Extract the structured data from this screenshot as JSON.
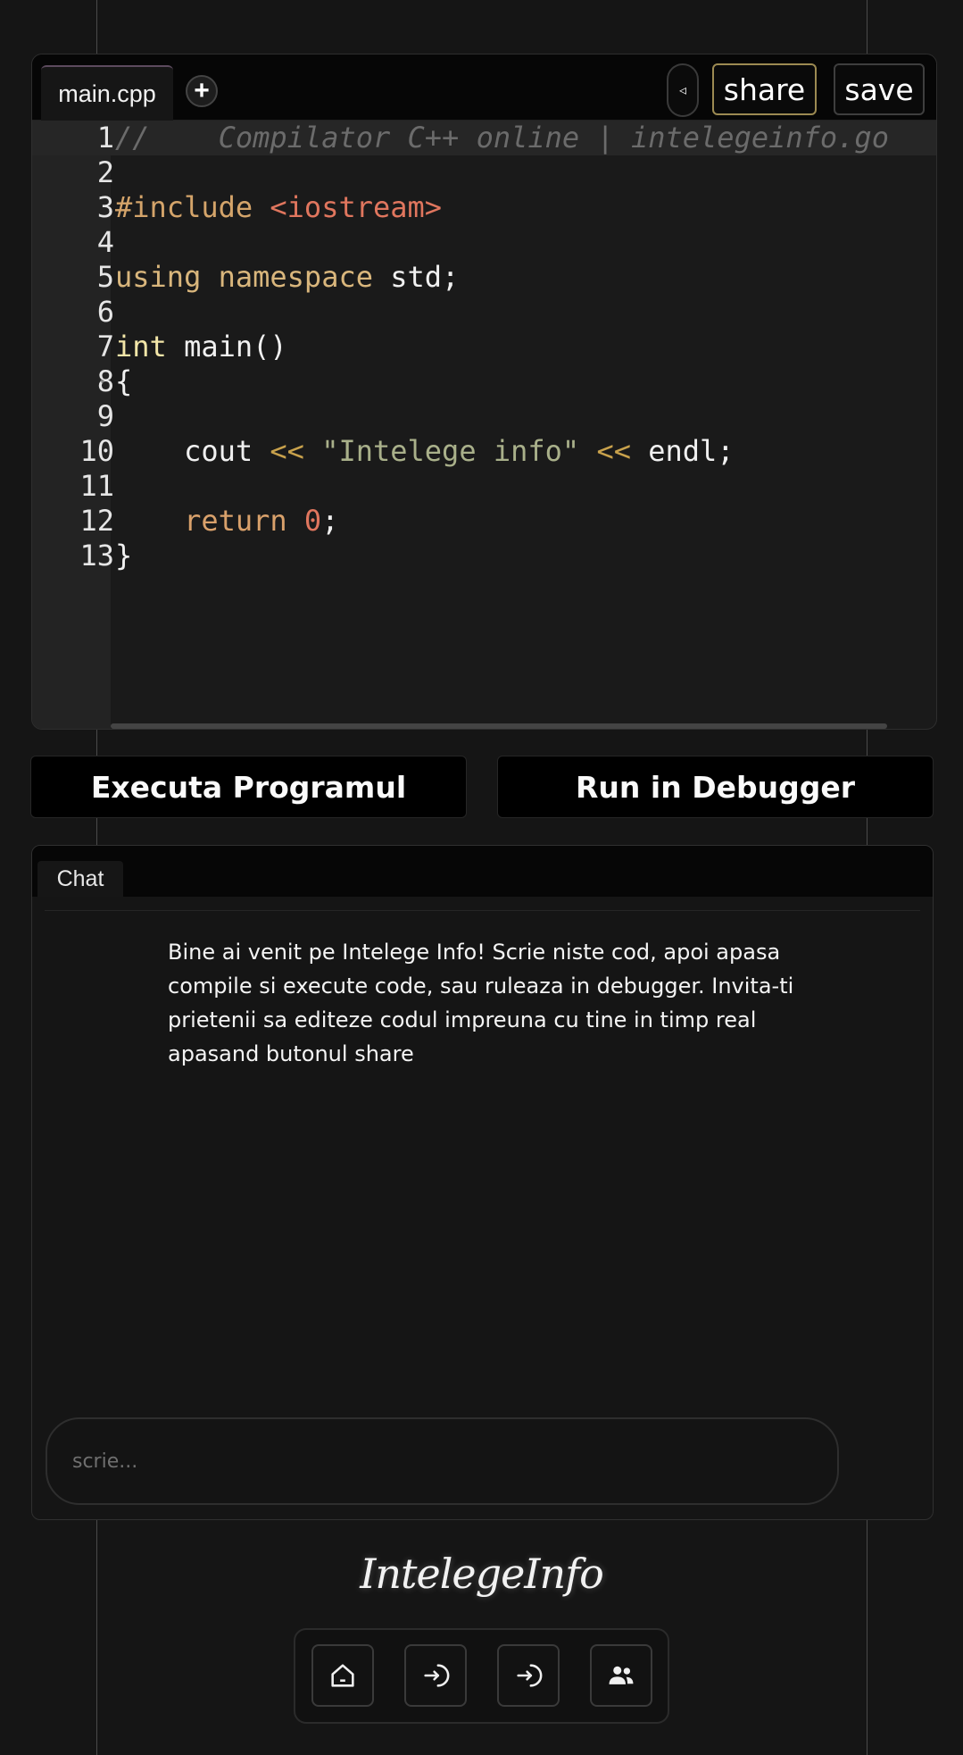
{
  "editor": {
    "file_tab": "main.cpp",
    "add_tab_icon": "plus-icon",
    "collapse_icon": "triangle-left-icon",
    "share_label": "share",
    "save_label": "save",
    "lines": [
      {
        "n": "1",
        "tokens": [
          {
            "t": "//    Compilator C++ online | intelegeinfo.go",
            "c": "comment"
          }
        ]
      },
      {
        "n": "2",
        "tokens": []
      },
      {
        "n": "3",
        "tokens": [
          {
            "t": "#include ",
            "c": "pre"
          },
          {
            "t": "<iostream>",
            "c": "inc"
          }
        ]
      },
      {
        "n": "4",
        "tokens": []
      },
      {
        "n": "5",
        "tokens": [
          {
            "t": "using namespace",
            "c": "kw"
          },
          {
            "t": " std;",
            "c": "plain"
          }
        ]
      },
      {
        "n": "6",
        "tokens": []
      },
      {
        "n": "7",
        "tokens": [
          {
            "t": "int",
            "c": "type"
          },
          {
            "t": " main()",
            "c": "plain"
          }
        ]
      },
      {
        "n": "8",
        "tokens": [
          {
            "t": "{",
            "c": "plain"
          }
        ],
        "fold": true
      },
      {
        "n": "9",
        "tokens": []
      },
      {
        "n": "10",
        "tokens": [
          {
            "t": "    cout ",
            "c": "plain"
          },
          {
            "t": "<<",
            "c": "op"
          },
          {
            "t": " ",
            "c": "plain"
          },
          {
            "t": "\"Intelege info\"",
            "c": "str"
          },
          {
            "t": " ",
            "c": "plain"
          },
          {
            "t": "<<",
            "c": "op"
          },
          {
            "t": " endl;",
            "c": "plain"
          }
        ]
      },
      {
        "n": "11",
        "tokens": []
      },
      {
        "n": "12",
        "tokens": [
          {
            "t": "    return",
            "c": "ret"
          },
          {
            "t": " ",
            "c": "plain"
          },
          {
            "t": "0",
            "c": "num"
          },
          {
            "t": ";",
            "c": "plain"
          }
        ]
      },
      {
        "n": "13",
        "tokens": [
          {
            "t": "}",
            "c": "plain"
          }
        ]
      }
    ]
  },
  "actions": {
    "execute_label": "Executa Programul",
    "debug_label": "Run in Debugger"
  },
  "chat": {
    "tab_label": "Chat",
    "welcome_message": "Bine ai venit pe Intelege Info! Scrie niste cod, apoi apasa compile si execute code, sau ruleaza in debugger. Invita-ti prietenii sa editeze codul impreuna cu tine in timp real apasand butonul share",
    "input_placeholder": "scrie..."
  },
  "footer": {
    "brand": "IntelegeInfo",
    "nav_icons": [
      "home-icon",
      "login-icon",
      "login-icon",
      "users-icon"
    ]
  }
}
